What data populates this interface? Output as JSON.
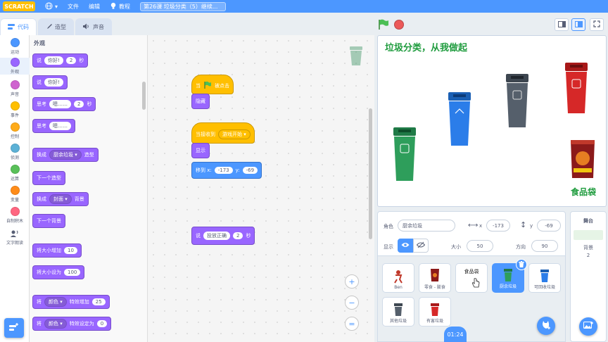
{
  "menubar": {
    "logo": "SCRATCH",
    "file": "文件",
    "edit": "编辑",
    "tutorial": "教程",
    "project_title": "第26课 垃圾分类（5）继续..."
  },
  "tabs": {
    "code": "代码",
    "costumes": "造型",
    "sounds": "声音"
  },
  "categories": [
    {
      "label": "运动",
      "color": "#4c97ff"
    },
    {
      "label": "外观",
      "color": "#9966ff"
    },
    {
      "label": "声音",
      "color": "#cf63cf"
    },
    {
      "label": "事件",
      "color": "#ffbf00"
    },
    {
      "label": "控制",
      "color": "#ffab19"
    },
    {
      "label": "侦测",
      "color": "#5cb1d6"
    },
    {
      "label": "运算",
      "color": "#59c059"
    },
    {
      "label": "变量",
      "color": "#ff8c1a"
    },
    {
      "label": "自制积木",
      "color": "#ff6680"
    },
    {
      "label": "文字朗读",
      "color": ""
    }
  ],
  "palette": {
    "title": "外观",
    "say_secs": {
      "say": "说",
      "msg": "你好!",
      "secs": "2",
      "unit": "秒"
    },
    "say": {
      "say": "说",
      "msg": "你好!"
    },
    "think_secs": {
      "think": "思考",
      "msg": "嗯……",
      "secs": "2",
      "unit": "秒"
    },
    "think": {
      "think": "思考",
      "msg": "嗯……"
    },
    "switch_costume": {
      "label": "换成",
      "value": "厨余垃圾",
      "suffix": "造型"
    },
    "next_costume": "下一个造型",
    "switch_backdrop": {
      "label": "换成",
      "value": "封面",
      "suffix": "背景"
    },
    "next_backdrop": "下一个背景",
    "change_size": {
      "label": "将大小增加",
      "value": "10"
    },
    "set_size": {
      "label": "将大小设为",
      "value": "100"
    },
    "change_effect": {
      "label": "将",
      "effect": "颜色",
      "suffix": "特效增加",
      "value": "25"
    },
    "set_effect": {
      "label": "将",
      "effect": "颜色",
      "suffix": "特效设定为",
      "value": "0"
    }
  },
  "scripts": {
    "when_flag": {
      "when": "当",
      "clicked": "被点击"
    },
    "hide": "隐藏",
    "when_receive": {
      "label": "当接收到",
      "value": "游戏开始"
    },
    "show": "显示",
    "goto": {
      "label": "移到 x:",
      "x": "-173",
      "ylabel": "y:",
      "y": "-69"
    },
    "say_secs": {
      "say": "说",
      "msg": "投放正确",
      "secs": "2",
      "unit": "秒"
    }
  },
  "zoom": {
    "in": "+",
    "out": "−",
    "reset": "="
  },
  "stage": {
    "title": "垃圾分类，从我做起",
    "label": "食品袋"
  },
  "sprite_info": {
    "sprite_label": "角色",
    "sprite_name": "厨余垃圾",
    "x_label": "x",
    "x": "-173",
    "y_label": "y",
    "y": "-69",
    "show_label": "显示",
    "size_label": "大小",
    "size": "50",
    "direction_label": "方向",
    "direction": "90"
  },
  "sprites": [
    {
      "name": "Ben"
    },
    {
      "name": "零食 - 膨食"
    },
    {
      "name": "食品袋"
    },
    {
      "name": "厨余垃圾"
    },
    {
      "name": "可回收垃圾"
    },
    {
      "name": "其他垃圾"
    },
    {
      "name": "有害垃圾"
    }
  ],
  "stage_panel": {
    "title": "舞台",
    "backdrop_label": "背景",
    "backdrop_count": "2"
  },
  "timer": "01:24"
}
